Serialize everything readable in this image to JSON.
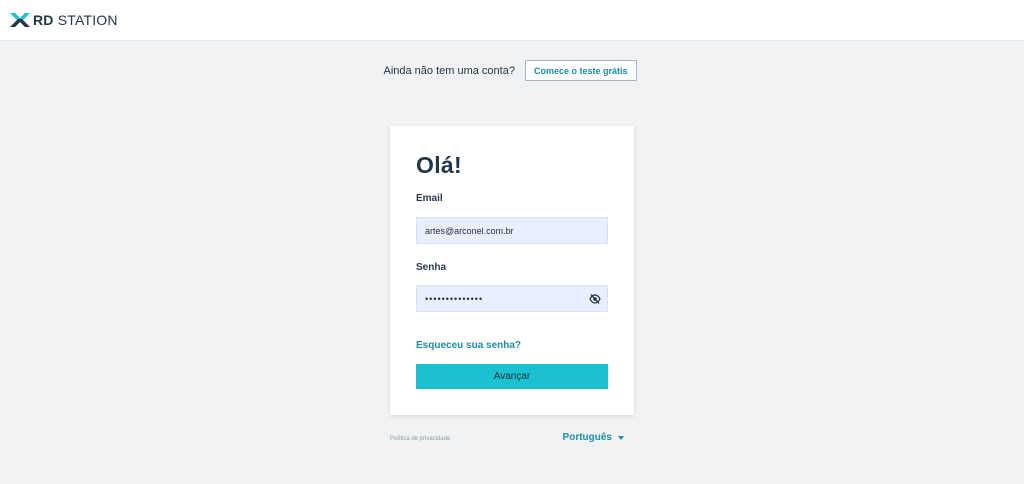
{
  "header": {
    "logo_bold": "RD",
    "logo_rest": " STATION"
  },
  "signup": {
    "prompt": "Ainda não tem uma conta?",
    "button_label": "Comece o teste grátis"
  },
  "login": {
    "greeting": "Olá!",
    "email_label": "Email",
    "email_value": "artes@arconel.com.br",
    "password_label": "Senha",
    "password_value": "••••••••••••••",
    "forgot_label": "Esqueceu sua senha?",
    "submit_label": "Avançar"
  },
  "footer": {
    "privacy_label": "Política de privacidade",
    "language_label": "Português"
  },
  "colors": {
    "accent": "#1cc1d1",
    "link": "#1b8ea3",
    "background": "#f0f2f4",
    "input_bg": "#e8f0fd"
  },
  "icons": {
    "logo": "rd-station-logo-icon",
    "password_toggle": "eye-slash-icon",
    "language_dropdown": "caret-down-icon"
  }
}
